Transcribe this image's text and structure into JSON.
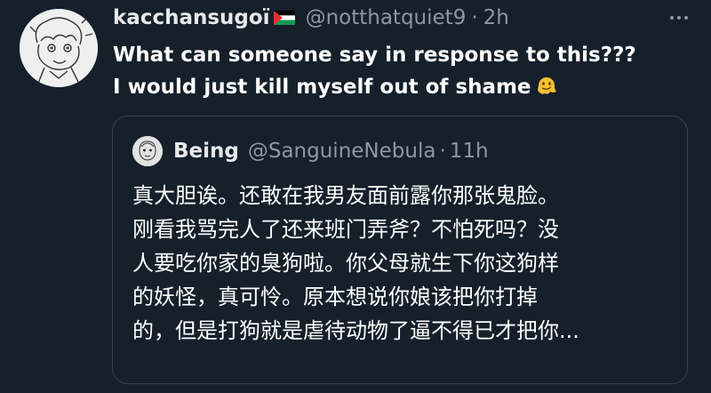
{
  "tweet": {
    "display_name": "kacchansugoï",
    "handle": "@notthatquiet9",
    "separator": "·",
    "time": "2h",
    "flag_icon": "palestine-flag-icon",
    "text_lines": [
      "What can someone say in response to this???",
      "I would just kill myself out of shame"
    ],
    "emoji_icon": "melting-face-emoji"
  },
  "quote": {
    "display_name": "Being",
    "handle": "@SanguineNebula",
    "separator": "·",
    "time": "11h",
    "text_lines": [
      "真大胆诶。还敢在我男友面前露你那张鬼脸。",
      "刚看我骂完人了还来班门弄斧？不怕死吗？没",
      "人要吃你家的臭狗啦。你父母就生下你这狗样",
      "的妖怪，真可怜。原本想说你娘该把你打掉",
      "的，但是打狗就是虐待动物了逼不得已才把你..."
    ]
  },
  "colors": {
    "background": "#15202b",
    "secondary_text": "#8b98a5",
    "border": "#38444d"
  }
}
